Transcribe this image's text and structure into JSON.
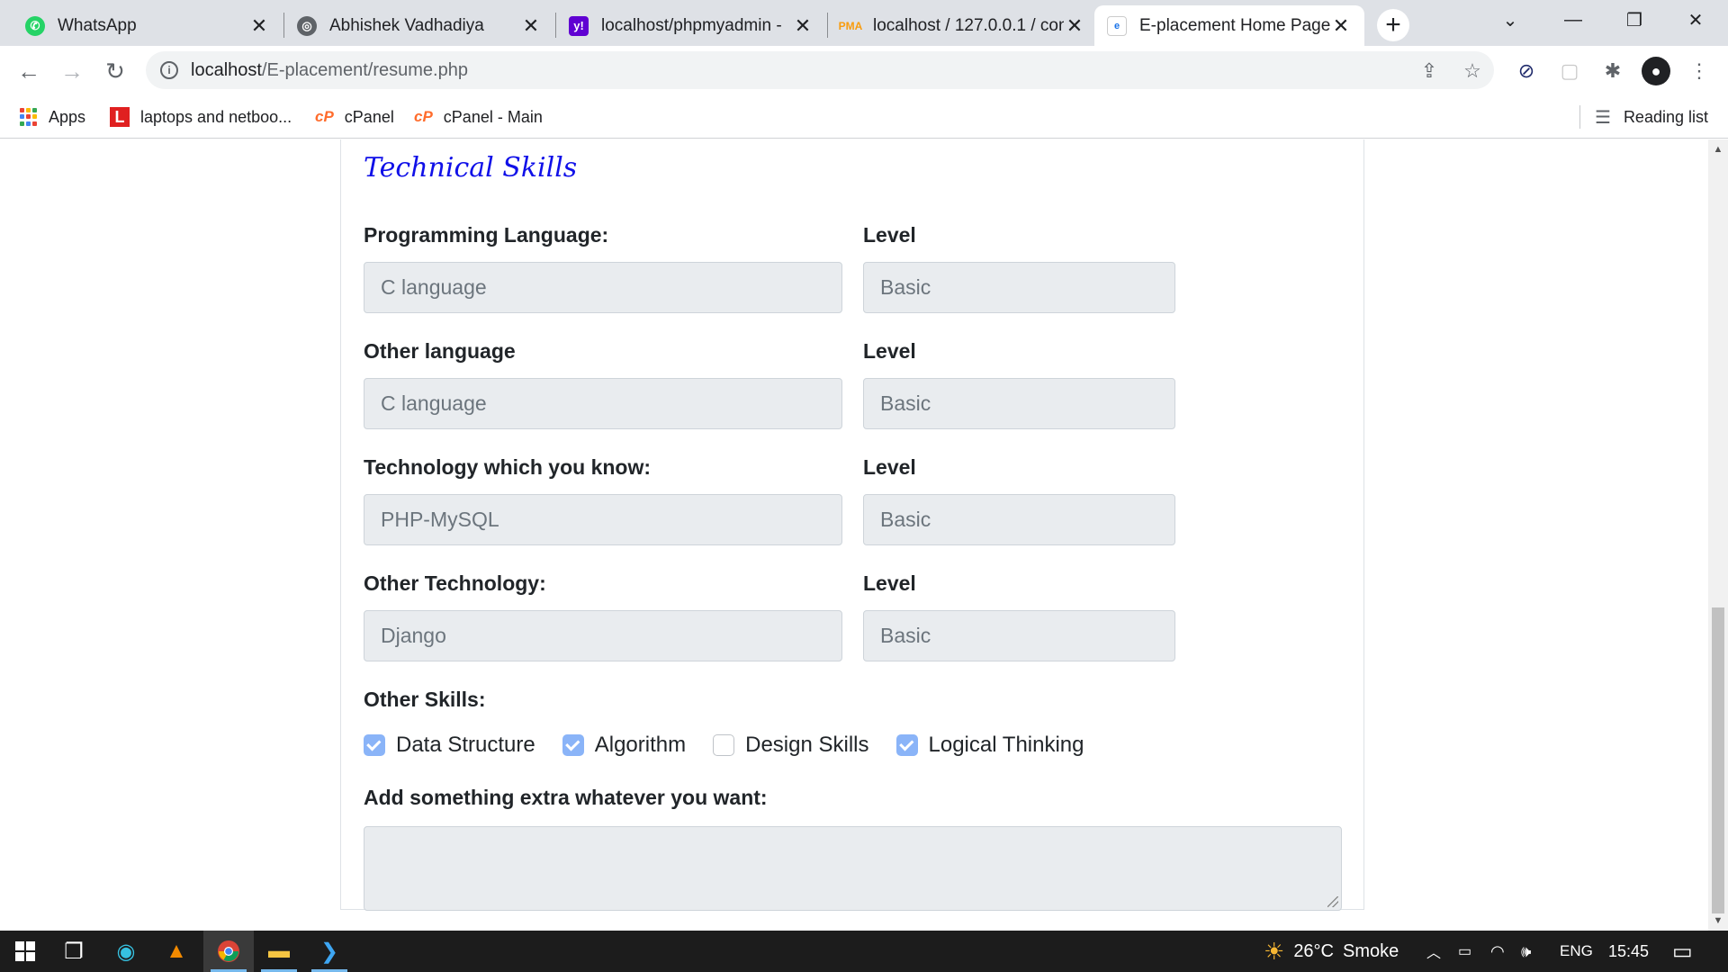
{
  "browser": {
    "tabs": [
      {
        "title": "WhatsApp",
        "icon": "whatsapp-icon",
        "active": false
      },
      {
        "title": "Abhishek Vadhadiya",
        "icon": "globe-icon",
        "active": false
      },
      {
        "title": "localhost/phpmyadmin -",
        "icon": "yahoo-icon",
        "active": false
      },
      {
        "title": "localhost / 127.0.0.1 / con",
        "icon": "phpmyadmin-icon",
        "active": false
      },
      {
        "title": "E-placement Home Page",
        "icon": "page-icon",
        "active": true
      }
    ],
    "new_tab": "+",
    "url_host": "localhost",
    "url_path": "/E-placement/resume.php",
    "bookmarks": [
      {
        "label": "Apps",
        "icon": "apps-grid-icon"
      },
      {
        "label": "laptops and netboo...",
        "icon": "lenovo-icon"
      },
      {
        "label": "cPanel",
        "icon": "cpanel-icon"
      },
      {
        "label": "cPanel - Main",
        "icon": "cpanel-icon"
      }
    ],
    "reading_list": "Reading list"
  },
  "form": {
    "section_title": "Technical Skills",
    "rows": [
      {
        "label": "Programming Language:",
        "value": "C language",
        "level_label": "Level",
        "level_value": "Basic"
      },
      {
        "label": "Other language",
        "value": "C language",
        "level_label": "Level",
        "level_value": "Basic"
      },
      {
        "label": "Technology which you know:",
        "value": "PHP-MySQL",
        "level_label": "Level",
        "level_value": "Basic"
      },
      {
        "label": "Other Technology:",
        "value": "Django",
        "level_label": "Level",
        "level_value": "Basic"
      }
    ],
    "other_skills_label": "Other Skills:",
    "other_skills": [
      {
        "label": "Data Structure",
        "checked": true
      },
      {
        "label": "Algorithm",
        "checked": true
      },
      {
        "label": "Design Skills",
        "checked": false
      },
      {
        "label": "Logical Thinking",
        "checked": true
      }
    ],
    "extra_label": "Add something extra whatever you want:",
    "extra_value": ""
  },
  "taskbar": {
    "weather_temp": "26°C",
    "weather_desc": "Smoke",
    "language": "ENG",
    "time": "15:45"
  },
  "colors": {
    "section_title": "#1010e8",
    "checkbox_on": "#8ab4f8",
    "field_bg": "#e9ecef"
  }
}
